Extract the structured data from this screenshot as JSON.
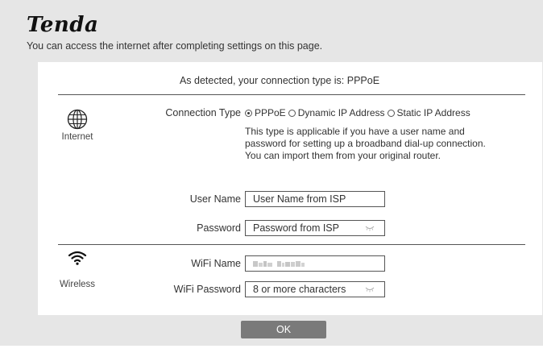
{
  "brand": {
    "logo_text": "Tenda"
  },
  "header": {
    "tip": "You can access the internet after completing settings on this page."
  },
  "detected": {
    "text": "As detected, your connection type is: PPPoE"
  },
  "internet": {
    "section_label": "Internet",
    "connection_type_label": "Connection Type",
    "options": [
      {
        "label": "PPPoE",
        "selected": true
      },
      {
        "label": "Dynamic IP Address",
        "selected": false
      },
      {
        "label": "Static IP Address",
        "selected": false
      }
    ],
    "description": "This type is applicable if you have a user name and password for setting up a broadband dial-up connection. You can import them from your original router.",
    "user_name_label": "User Name",
    "user_name_placeholder": "User Name from ISP",
    "password_label": "Password",
    "password_placeholder": "Password from ISP"
  },
  "wireless": {
    "section_label": "Wireless",
    "wifi_name_label": "WiFi Name",
    "wifi_password_label": "WiFi Password",
    "wifi_password_placeholder": "8 or more characters"
  },
  "footer": {
    "ok_label": "OK"
  },
  "icons": {
    "internet": "globe-icon",
    "wireless": "wifi-icon",
    "password_eye": "eye-closed-icon"
  },
  "colors": {
    "band": "#e6e6e6",
    "button": "#7a7a7a",
    "border": "#555555"
  }
}
